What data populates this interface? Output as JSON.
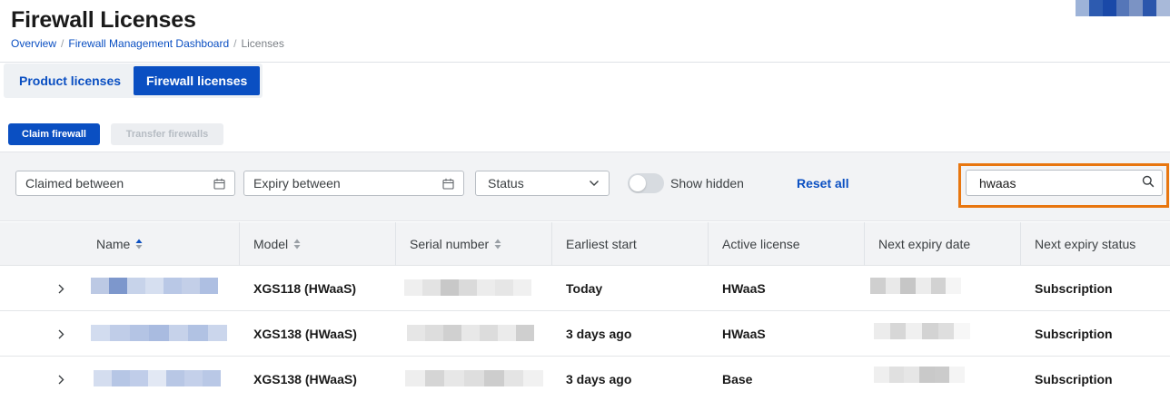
{
  "header": {
    "title": "Firewall Licenses",
    "breadcrumb": [
      "Overview",
      "Firewall Management Dashboard",
      "Licenses"
    ],
    "brand_colors": [
      "#9db3d8",
      "#2d5bb0",
      "#1a49a8",
      "#5576b8",
      "#7b93c4",
      "#2b56ac",
      "#a8b9d9"
    ]
  },
  "tabs": [
    {
      "label": "Product licenses",
      "active": false
    },
    {
      "label": "Firewall licenses",
      "active": true
    }
  ],
  "actions": {
    "claim_label": "Claim firewall",
    "transfer_label": "Transfer firewalls"
  },
  "filters": {
    "claimed_placeholder": "Claimed between",
    "expiry_placeholder": "Expiry between",
    "status_label": "Status",
    "show_hidden_label": "Show hidden",
    "show_hidden_on": false,
    "reset_label": "Reset all",
    "search_value": "hwaas"
  },
  "table": {
    "columns": [
      "Name",
      "Model",
      "Serial number",
      "Earliest start",
      "Active license",
      "Next expiry date",
      "Next expiry status"
    ],
    "rows": [
      {
        "model": "XGS118 (HWaaS)",
        "earliest_start": "Today",
        "active_license": "HWaaS",
        "next_expiry_status": "Subscription"
      },
      {
        "model": "XGS138 (HWaaS)",
        "earliest_start": "3 days ago",
        "active_license": "HWaaS",
        "next_expiry_status": "Subscription"
      },
      {
        "model": "XGS138 (HWaaS)",
        "earliest_start": "3 days ago",
        "active_license": "Base",
        "next_expiry_status": "Subscription"
      }
    ]
  },
  "colors": {
    "accent": "#0a4fc2",
    "highlight": "#e8760f"
  }
}
